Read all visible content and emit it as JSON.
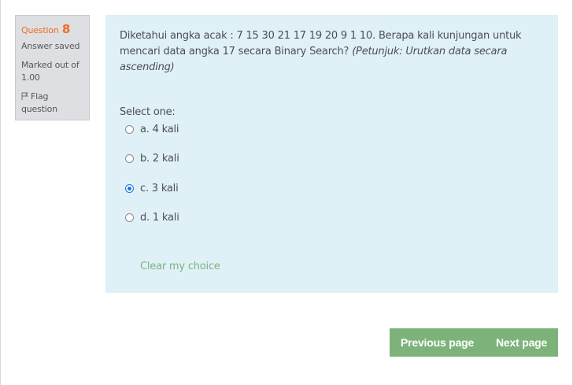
{
  "info": {
    "question_label": "Question",
    "question_number": "8",
    "state": "Answer saved",
    "grade": "Marked out of 1.00",
    "flag_label": "Flag question"
  },
  "question": {
    "text": "Diketahui angka acak : 7 15 30 21 17 19 20 9 1 10. Berapa kali kunjungan untuk mencari data angka 17 secara Binary Search?",
    "hint": "(Petunjuk: Urutkan data secara ascending)",
    "prompt": "Select one:",
    "options": [
      {
        "label": "a. 4 kali",
        "checked": false
      },
      {
        "label": "b. 2 kali",
        "checked": false
      },
      {
        "label": "c. 3 kali",
        "checked": true
      },
      {
        "label": "d. 1 kali",
        "checked": false
      }
    ],
    "clear_label": "Clear my choice"
  },
  "navigation": {
    "previous_label": "Previous page",
    "next_label": "Next page"
  },
  "colors": {
    "accent_orange": "#f26b21",
    "content_bg": "#dff0f7",
    "button_green": "#7db37a",
    "radio_blue": "#1a73e8"
  }
}
